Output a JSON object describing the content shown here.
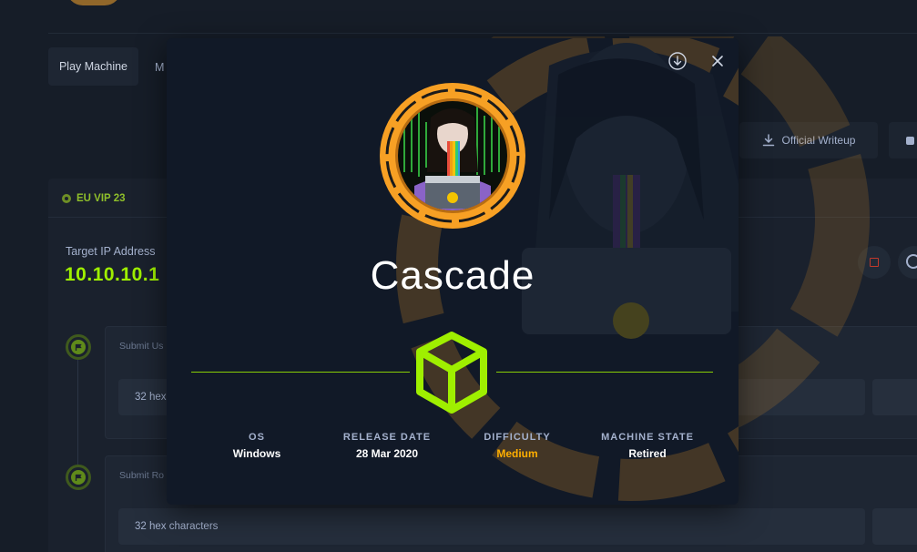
{
  "page": {
    "tabs": [
      {
        "label": "Play Machine"
      },
      {
        "label": "M"
      }
    ],
    "official_writeup_label": "Official Writeup",
    "vpn_server_label": "EU VIP 23",
    "target": {
      "label": "Target IP Address",
      "ip": "10.10.10.1"
    },
    "flags": [
      {
        "title": "Submit Us",
        "placeholder": "32 hex"
      },
      {
        "title": "Submit Ro",
        "placeholder": "32 hex characters"
      }
    ]
  },
  "modal": {
    "machine_name": "Cascade",
    "stats": {
      "os": {
        "label": "OS",
        "value": "Windows"
      },
      "release_date": {
        "label": "RELEASE DATE",
        "value": "28 Mar 2020"
      },
      "difficulty": {
        "label": "DIFFICULTY",
        "value": "Medium"
      },
      "machine_state": {
        "label": "MACHINE STATE",
        "value": "Retired"
      }
    },
    "icons": {
      "download": "download-circle-icon",
      "close": "close-icon",
      "difficulty": "cube-icon"
    }
  },
  "colors": {
    "accent_green": "#9fef00",
    "difficulty_medium": "#ffaf00",
    "avatar_ring": "#f7a024",
    "stop": "#c0392b"
  }
}
